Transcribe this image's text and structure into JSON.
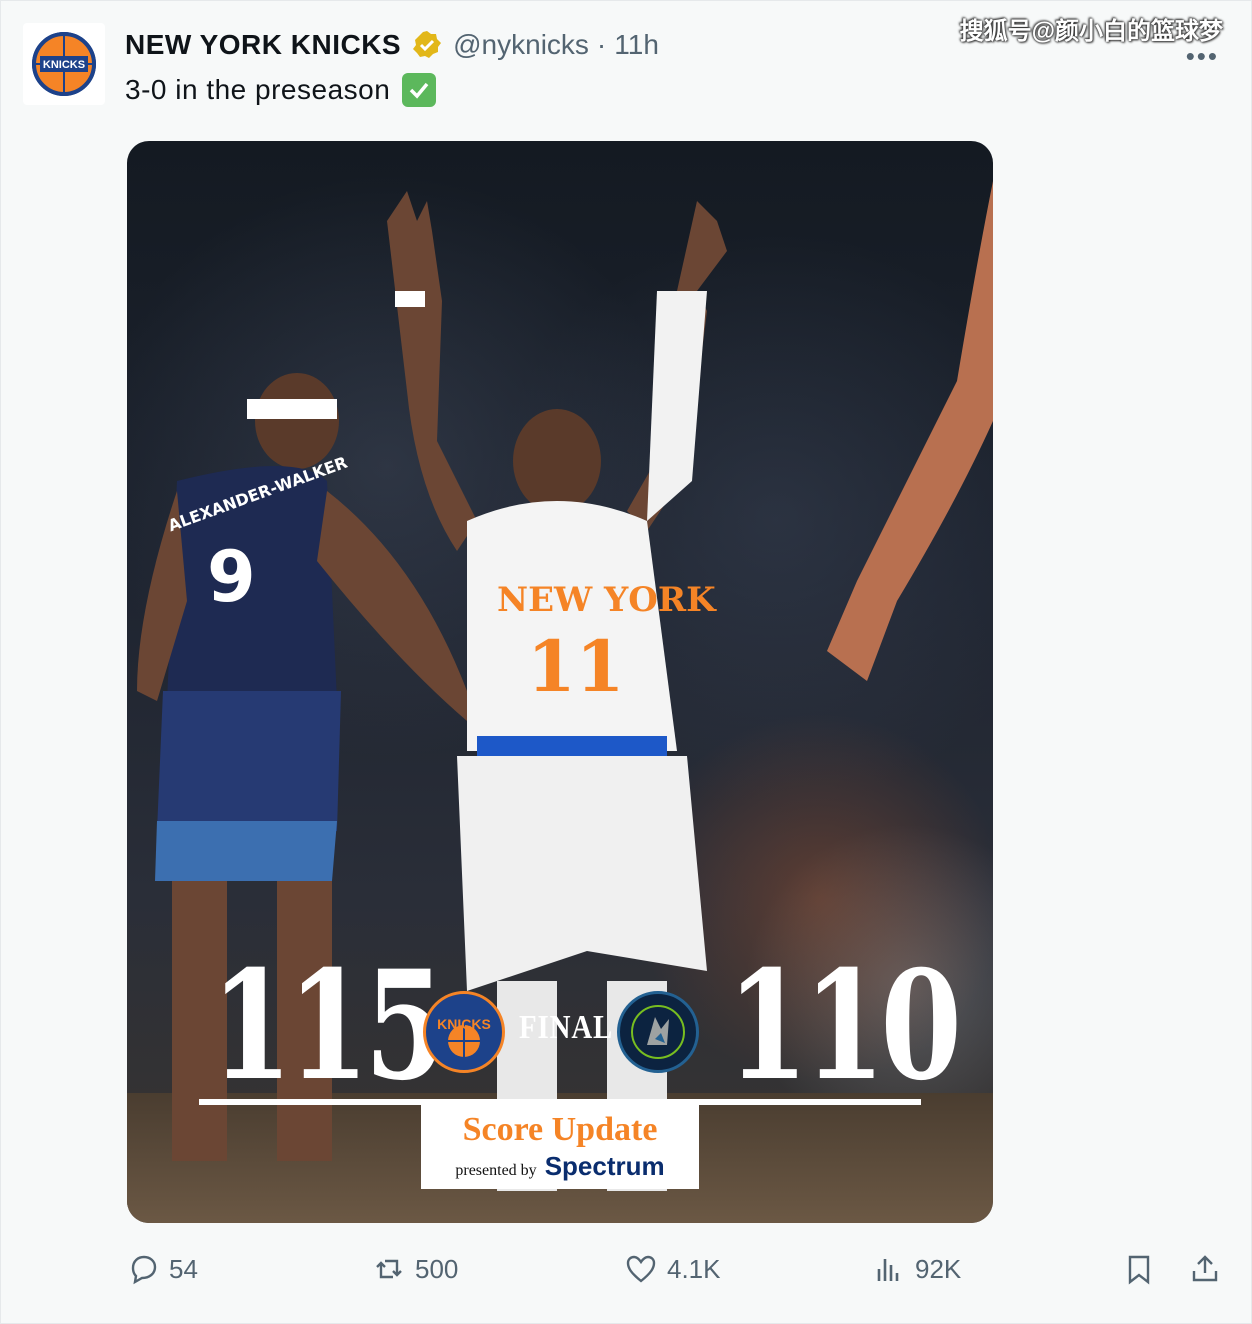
{
  "account": {
    "name": "NEW YORK KNICKS",
    "handle": "@nyknicks",
    "separator": "·",
    "time": "11h",
    "avatar_text": "KNICKS"
  },
  "watermark": "搜狐号@颜小白的篮球梦",
  "tweet": {
    "text": "3-0 in the preseason"
  },
  "graphic": {
    "home_score": "115",
    "away_score": "110",
    "status": "FINAL",
    "home_logo_text": "KNICKS",
    "sponsor_title": "Score Update",
    "sponsor_sub": "presented by",
    "sponsor_brand": "Spectrum",
    "home_jersey_name": "NEW YORK",
    "home_jersey_number": "11",
    "away_jersey_name": "ALEXANDER-WALKER",
    "away_jersey_number": "9"
  },
  "actions": {
    "replies": "54",
    "reposts": "500",
    "likes": "4.1K",
    "views": "92K"
  },
  "colors": {
    "knicks_orange": "#f58426",
    "knicks_blue": "#1d428a",
    "wolves_navy": "#0c2340",
    "muted": "#536471"
  },
  "icons": [
    "verified-badge-icon",
    "more-icon",
    "check-emoji-icon",
    "reply-icon",
    "repost-icon",
    "like-icon",
    "views-icon",
    "bookmark-icon",
    "share-icon"
  ]
}
